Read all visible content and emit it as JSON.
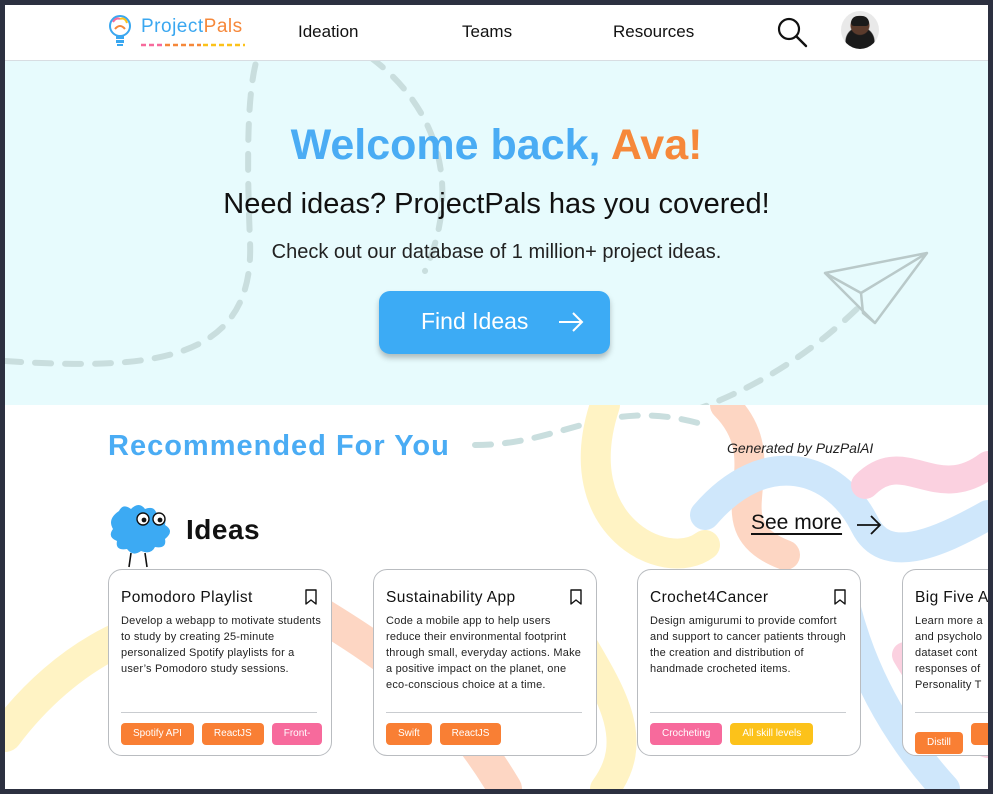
{
  "header": {
    "logo": {
      "part1": "Project",
      "part2": "Pals"
    },
    "nav": [
      "Ideation",
      "Teams",
      "Resources"
    ],
    "search_icon": "search-icon",
    "avatar": "user-avatar"
  },
  "hero": {
    "greeting": "Welcome back, ",
    "name": "Ava!",
    "subtitle": "Need ideas? ProjectPals has you covered!",
    "description": "Check out our database of 1 million+ project ideas.",
    "cta_label": "Find Ideas",
    "cta_icon": "arrow-right-icon",
    "decoration_icon": "paper-plane-icon"
  },
  "recommended": {
    "title": "Recommended For You",
    "generated_by": "Generated by PuzPalAI"
  },
  "ideas": {
    "title": "Ideas",
    "mascot_icon": "puzzle-piece-mascot-icon",
    "see_more_label": "See more",
    "cards": [
      {
        "title": "Pomodoro Playlist",
        "description": "Develop a webapp to motivate students to study by creating  25-minute personalized Spotify playlists for a user’s Pomodoro study sessions.",
        "tags": [
          {
            "label": "Spotify API",
            "color": "#f97f34"
          },
          {
            "label": "ReactJS",
            "color": "#f97f34"
          },
          {
            "label": "Front-",
            "color": "#f76a9c"
          }
        ]
      },
      {
        "title": "Sustainability App",
        "description": "Code a mobile app to help users reduce their environmental footprint through small, everyday actions. Make a positive impact on the planet, one eco-conscious choice at a time.",
        "tags": [
          {
            "label": "Swift",
            "color": "#f97f34"
          },
          {
            "label": "ReactJS",
            "color": "#f97f34"
          }
        ]
      },
      {
        "title": "Crochet4Cancer",
        "description": "Design amigurumi to provide comfort and support to cancer patients through the creation and distribution of handmade crocheted items.",
        "tags": [
          {
            "label": "Crocheting",
            "color": "#f76a9c"
          },
          {
            "label": "All skill levels",
            "color": "#fcc21a"
          }
        ]
      },
      {
        "title": "Big Five A",
        "description": "Learn more a and psycholo dataset cont responses of Personality T",
        "tags": [
          {
            "label": "Distill",
            "color": "#f97f34"
          },
          {
            "label": "",
            "color": "#f97f34"
          }
        ]
      }
    ]
  },
  "colors": {
    "brand_blue": "#4aacf4",
    "brand_orange": "#f6883a",
    "hero_bg": "#e7fbfd"
  }
}
